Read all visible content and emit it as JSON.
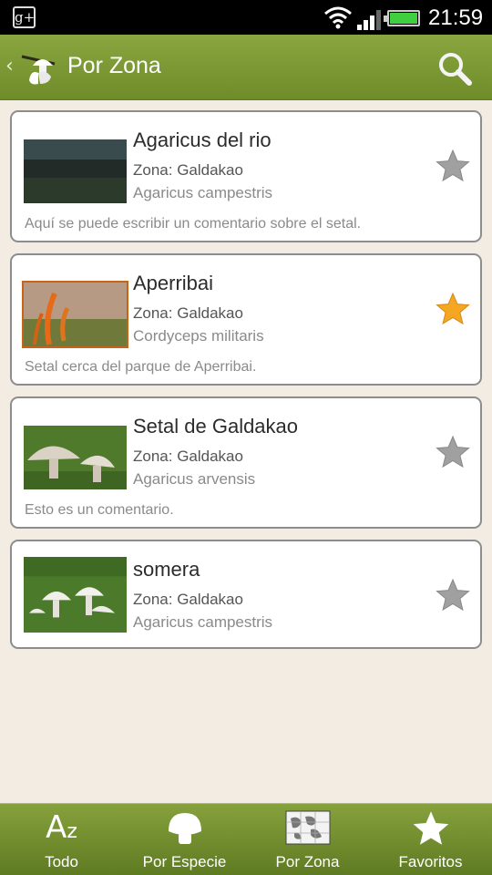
{
  "status_bar": {
    "time": "21:59",
    "notification_glyph": "g+"
  },
  "action_bar": {
    "title": "Por Zona"
  },
  "items": [
    {
      "name": "Agaricus del rio",
      "zona": "Zona: Galdakao",
      "species": "Agaricus campestris",
      "comment": "Aquí se puede escribir un comentario sobre el setal.",
      "favorite": false
    },
    {
      "name": "Aperribai",
      "zona": "Zona: Galdakao",
      "species": "Cordyceps militaris",
      "comment": "Setal cerca del parque de Aperribai.",
      "favorite": true
    },
    {
      "name": "Setal de Galdakao",
      "zona": "Zona: Galdakao",
      "species": "Agaricus arvensis",
      "comment": "Esto es un comentario.",
      "favorite": false
    },
    {
      "name": "somera",
      "zona": "Zona: Galdakao",
      "species": "Agaricus campestris",
      "comment": "",
      "favorite": false
    }
  ],
  "tabs": [
    {
      "label": "Todo",
      "icon": "az-sort-icon"
    },
    {
      "label": "Por Especie",
      "icon": "mushroom-icon"
    },
    {
      "label": "Por Zona",
      "icon": "map-icon"
    },
    {
      "label": "Favoritos",
      "icon": "star-icon"
    }
  ],
  "colors": {
    "accent_green": "#7b9633",
    "star_favorite": "#f5a623",
    "star_default": "#9b9b9b"
  }
}
